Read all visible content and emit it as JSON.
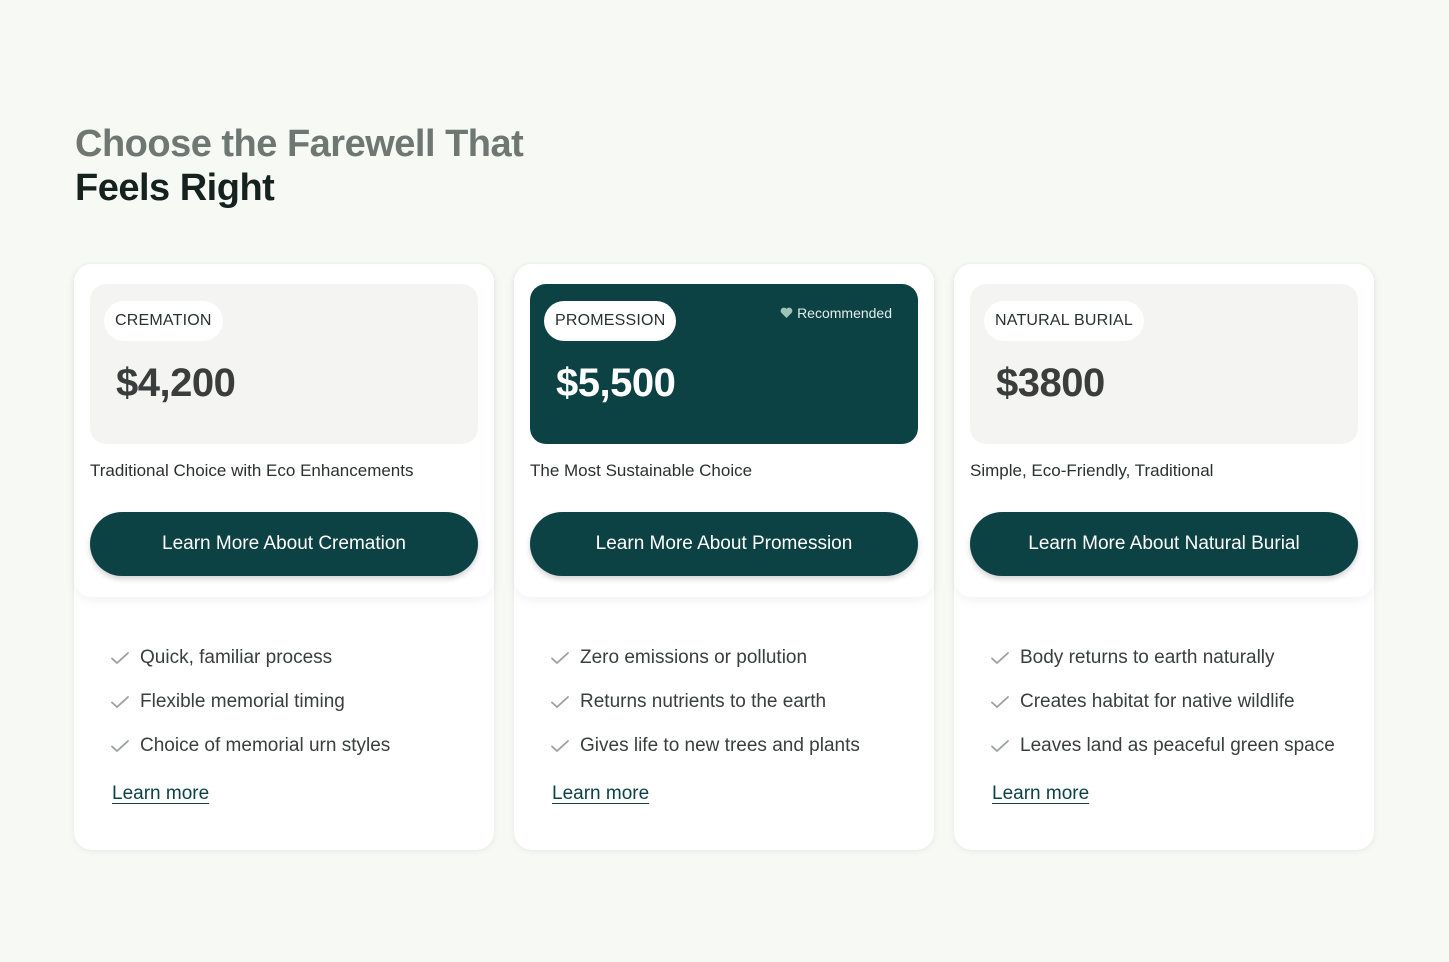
{
  "heading": {
    "line1": "Choose the Farewell That",
    "line2": "Feels Right"
  },
  "colors": {
    "page_background": "#f6f9f4",
    "brand_dark_teal": "#0d4244",
    "card_background": "#ffffff",
    "price_box_light": "#f4f4f3"
  },
  "cards": [
    {
      "tag": "CREMATION",
      "price": "$4,200",
      "subtitle": "Traditional Choice with Eco Enhancements",
      "cta_label": "Learn More About Cremation",
      "features": [
        "Quick, familiar process",
        "Flexible memorial timing",
        "Choice of memorial urn styles"
      ],
      "link_label": "Learn more"
    },
    {
      "tag": "PROMESSION",
      "price": "$5,500",
      "badge": "Recommended",
      "badge_icon": "heart-icon",
      "subtitle": "The Most Sustainable Choice",
      "cta_label": "Learn More About Promession",
      "features": [
        "Zero emissions or pollution",
        "Returns nutrients to the earth",
        "Gives life to new trees and plants"
      ],
      "link_label": "Learn more"
    },
    {
      "tag": "NATURAL BURIAL",
      "price": "$3800",
      "subtitle": "Simple, Eco-Friendly, Traditional",
      "cta_label": "Learn More About Natural Burial",
      "features": [
        "Body returns to earth naturally",
        "Creates habitat for native wildlife",
        "Leaves land as peaceful green space"
      ],
      "link_label": "Learn more"
    }
  ],
  "feature_icon": "check-icon"
}
